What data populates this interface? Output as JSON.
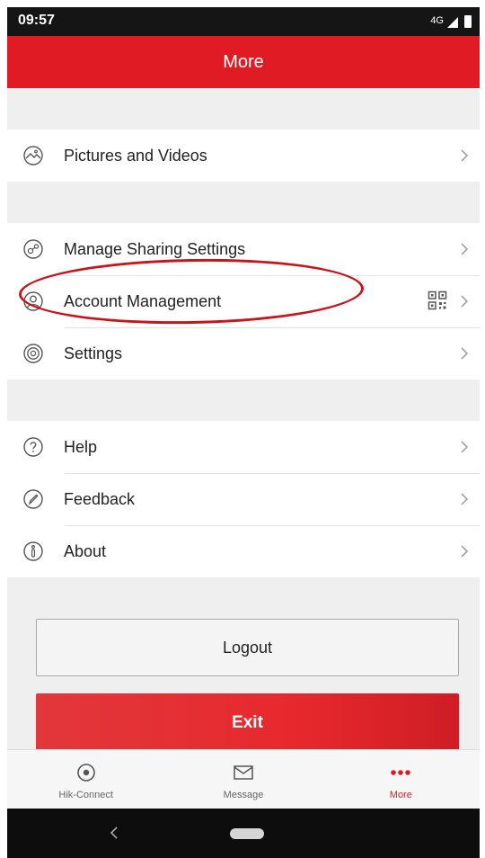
{
  "status_bar": {
    "time": "09:57",
    "network": "4G"
  },
  "header": {
    "title": "More"
  },
  "menu": {
    "group1": [
      {
        "label": "Pictures and Videos",
        "icon": "gallery-icon"
      }
    ],
    "group2": [
      {
        "label": "Manage Sharing Settings",
        "icon": "share-icon"
      },
      {
        "label": "Account Management",
        "icon": "person-icon"
      },
      {
        "label": "Settings",
        "icon": "settings-icon"
      }
    ],
    "group3": [
      {
        "label": "Help",
        "icon": "help-icon"
      },
      {
        "label": "Feedback",
        "icon": "feedback-icon"
      },
      {
        "label": "About",
        "icon": "info-icon"
      }
    ]
  },
  "buttons": {
    "logout": "Logout",
    "exit": "Exit"
  },
  "tabs": [
    {
      "label": "Hik-Connect",
      "icon": "camera-eye-icon",
      "active": false
    },
    {
      "label": "Message",
      "icon": "envelope-icon",
      "active": false
    },
    {
      "label": "More",
      "icon": "dots-icon",
      "active": true
    }
  ],
  "colors": {
    "accent": "#e01b24",
    "background": "#efefef",
    "annotation": "#c4161c"
  }
}
